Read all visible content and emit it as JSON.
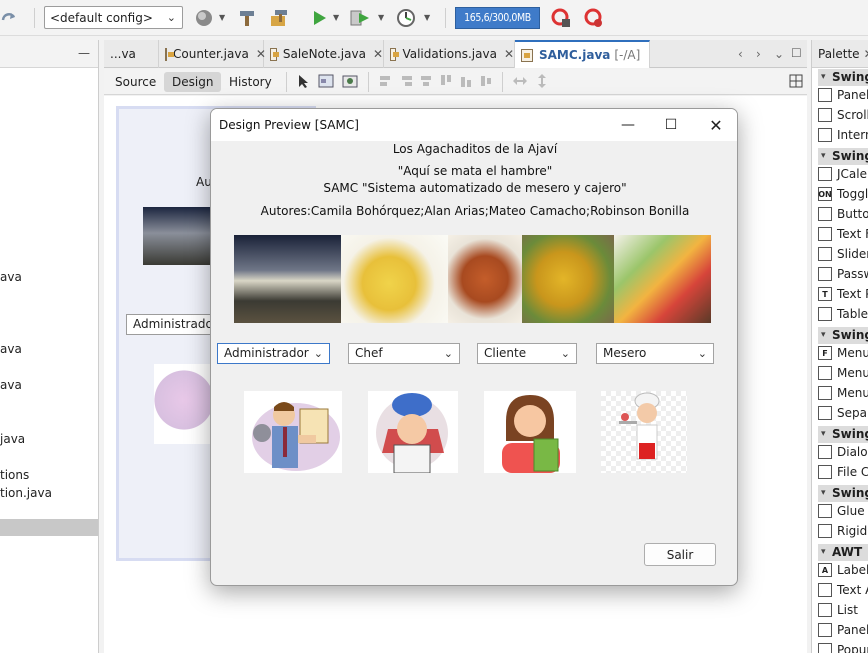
{
  "toolbar": {
    "config_value": "<default config>",
    "memory_label": "165,6/300,0MB"
  },
  "tabs": [
    {
      "label": "...va"
    },
    {
      "label": "Counter.java"
    },
    {
      "label": "SaleNote.java"
    },
    {
      "label": "Validations.java"
    },
    {
      "label": "SAMC.java",
      "suffix": "[-/A]"
    }
  ],
  "subtabs": {
    "source": "Source",
    "design": "Design",
    "history": "History"
  },
  "left_tree": [
    "ava",
    "ava",
    "ava",
    "java",
    "tions",
    "tion.java"
  ],
  "designer": {
    "author_fragment": "Au",
    "combo_value": "Administrador"
  },
  "palette": {
    "title": "Palette",
    "items": [
      {
        "type": "cat",
        "label": "Swing"
      },
      {
        "type": "item",
        "label": "Panel"
      },
      {
        "type": "item",
        "label": "Scroll"
      },
      {
        "type": "item",
        "label": "Intern"
      },
      {
        "type": "cat",
        "label": "Swing"
      },
      {
        "type": "item",
        "label": "JCaler"
      },
      {
        "type": "item",
        "label": "Toggl"
      },
      {
        "type": "item",
        "label": "Butto"
      },
      {
        "type": "item",
        "label": "Text F"
      },
      {
        "type": "item",
        "label": "Slider"
      },
      {
        "type": "item",
        "label": "Passw"
      },
      {
        "type": "item",
        "label": "Text P"
      },
      {
        "type": "item",
        "label": "Table"
      },
      {
        "type": "cat",
        "label": "Swing"
      },
      {
        "type": "item",
        "label": "Menu"
      },
      {
        "type": "item",
        "label": "Menu"
      },
      {
        "type": "item",
        "label": "Menu"
      },
      {
        "type": "item",
        "label": "Separ"
      },
      {
        "type": "cat",
        "label": "Swing"
      },
      {
        "type": "item",
        "label": "Dialog"
      },
      {
        "type": "item",
        "label": "File Cl"
      },
      {
        "type": "cat",
        "label": "Swing"
      },
      {
        "type": "item",
        "label": "Glue"
      },
      {
        "type": "item",
        "label": "Rigid"
      },
      {
        "type": "cat",
        "label": "AWT"
      },
      {
        "type": "item",
        "label": "Label"
      },
      {
        "type": "item",
        "label": "Text A"
      },
      {
        "type": "item",
        "label": "List"
      },
      {
        "type": "item",
        "label": "Panel"
      },
      {
        "type": "item",
        "label": "Popup"
      }
    ]
  },
  "dialog": {
    "title": "Design Preview [SAMC]",
    "line1": "Los Agachaditos de la Ajaví",
    "line2": "\"Aquí se mata el hambre\"",
    "line3": "SAMC \"Sistema automatizado de mesero y cajero\"",
    "authors": "Autores:Camila Bohórquez;Alan Arias;Mateo Camacho;Robinson Bonilla",
    "combos": [
      "Administrador",
      "Chef",
      "Cliente",
      "Mesero"
    ],
    "exit_label": "Salir"
  }
}
